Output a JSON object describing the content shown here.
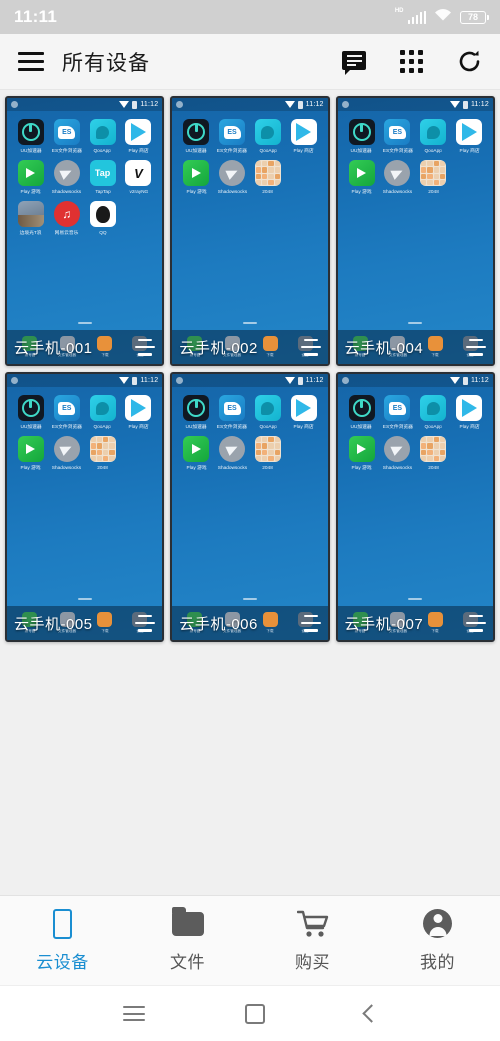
{
  "status_bar": {
    "time": "11:11",
    "signal_icon": "signal-bars-icon",
    "signal_label": "HD",
    "wifi_icon": "wifi-icon",
    "battery_icon": "battery-icon",
    "battery_level": "78"
  },
  "header": {
    "menu_icon": "hamburger-menu-icon",
    "title": "所有设备",
    "actions": [
      {
        "icon": "message-icon"
      },
      {
        "icon": "grid-view-icon"
      },
      {
        "icon": "refresh-icon"
      }
    ]
  },
  "devices": [
    {
      "name": "云手机-001",
      "status_time": "11:12",
      "menu_icon": "device-menu-icon",
      "apps": [
        {
          "label": "UU加速器",
          "icon": "uu-accelerator-icon",
          "style": "ico-uu"
        },
        {
          "label": "ES文件浏览器",
          "icon": "es-file-explorer-icon",
          "style": "ico-es"
        },
        {
          "label": "QooApp",
          "icon": "qooapp-icon",
          "style": "ico-qoo"
        },
        {
          "label": "Play 商店",
          "icon": "google-play-icon",
          "style": "ico-play"
        },
        {
          "label": "Play 游戏",
          "icon": "play-games-icon",
          "style": "ico-playgame"
        },
        {
          "label": "Shadowsocks",
          "icon": "shadowsocks-icon",
          "style": "ico-ss"
        },
        {
          "label": "TapTap",
          "icon": "taptap-icon",
          "style": "ico-tap"
        },
        {
          "label": "v2rayNG",
          "icon": "v2rayng-icon",
          "style": "ico-v2"
        },
        {
          "label": "边境光T浪",
          "icon": "photo-app-icon",
          "style": "ico-photo"
        },
        {
          "label": "网易云音乐",
          "icon": "netease-music-icon",
          "style": "ico-music"
        },
        {
          "label": "QQ",
          "icon": "qq-icon",
          "style": "ico-qq"
        }
      ],
      "dock": [
        {
          "label": "拨号器",
          "icon": "dialer-icon",
          "color": "#2f8f4f"
        },
        {
          "label": "文件管理器",
          "icon": "file-manager-icon",
          "color": "#8c97a4"
        },
        {
          "label": "下载",
          "icon": "download-icon",
          "color": "#e8913a"
        },
        {
          "label": "设置",
          "icon": "settings-icon",
          "color": "#5b6b7c"
        }
      ]
    },
    {
      "name": "云手机-002",
      "status_time": "11:12",
      "menu_icon": "device-menu-icon",
      "apps": [
        {
          "label": "UU加速器",
          "icon": "uu-accelerator-icon",
          "style": "ico-uu"
        },
        {
          "label": "ES文件浏览器",
          "icon": "es-file-explorer-icon",
          "style": "ico-es"
        },
        {
          "label": "QooApp",
          "icon": "qooapp-icon",
          "style": "ico-qoo"
        },
        {
          "label": "Play 商店",
          "icon": "google-play-icon",
          "style": "ico-play"
        },
        {
          "label": "Play 游戏",
          "icon": "play-games-icon",
          "style": "ico-playgame"
        },
        {
          "label": "Shadowsocks",
          "icon": "shadowsocks-icon",
          "style": "ico-ss"
        },
        {
          "label": "2048",
          "icon": "2048-game-icon",
          "style": "ico-2048"
        }
      ],
      "dock": [
        {
          "label": "拨号器",
          "icon": "dialer-icon",
          "color": "#2f8f4f"
        },
        {
          "label": "文件管理器",
          "icon": "file-manager-icon",
          "color": "#8c97a4"
        },
        {
          "label": "下载",
          "icon": "download-icon",
          "color": "#e8913a"
        },
        {
          "label": "设置",
          "icon": "settings-icon",
          "color": "#5b6b7c"
        }
      ]
    },
    {
      "name": "云手机-004",
      "status_time": "11:12",
      "menu_icon": "device-menu-icon",
      "apps": [
        {
          "label": "UU加速器",
          "icon": "uu-accelerator-icon",
          "style": "ico-uu"
        },
        {
          "label": "ES文件浏览器",
          "icon": "es-file-explorer-icon",
          "style": "ico-es"
        },
        {
          "label": "QooApp",
          "icon": "qooapp-icon",
          "style": "ico-qoo"
        },
        {
          "label": "Play 商店",
          "icon": "google-play-icon",
          "style": "ico-play"
        },
        {
          "label": "Play 游戏",
          "icon": "play-games-icon",
          "style": "ico-playgame"
        },
        {
          "label": "Shadowsocks",
          "icon": "shadowsocks-icon",
          "style": "ico-ss"
        },
        {
          "label": "2048",
          "icon": "2048-game-icon",
          "style": "ico-2048"
        }
      ],
      "dock": [
        {
          "label": "拨号器",
          "icon": "dialer-icon",
          "color": "#2f8f4f"
        },
        {
          "label": "文件管理器",
          "icon": "file-manager-icon",
          "color": "#8c97a4"
        },
        {
          "label": "下载",
          "icon": "download-icon",
          "color": "#e8913a"
        },
        {
          "label": "设置",
          "icon": "settings-icon",
          "color": "#5b6b7c"
        }
      ]
    },
    {
      "name": "云手机-005",
      "status_time": "11:12",
      "menu_icon": "device-menu-icon",
      "apps": [
        {
          "label": "UU加速器",
          "icon": "uu-accelerator-icon",
          "style": "ico-uu"
        },
        {
          "label": "ES文件浏览器",
          "icon": "es-file-explorer-icon",
          "style": "ico-es"
        },
        {
          "label": "QooApp",
          "icon": "qooapp-icon",
          "style": "ico-qoo"
        },
        {
          "label": "Play 商店",
          "icon": "google-play-icon",
          "style": "ico-play"
        },
        {
          "label": "Play 游戏",
          "icon": "play-games-icon",
          "style": "ico-playgame"
        },
        {
          "label": "Shadowsocks",
          "icon": "shadowsocks-icon",
          "style": "ico-ss"
        },
        {
          "label": "2048",
          "icon": "2048-game-icon",
          "style": "ico-2048"
        }
      ],
      "dock": [
        {
          "label": "拨号器",
          "icon": "dialer-icon",
          "color": "#2f8f4f"
        },
        {
          "label": "文件管理器",
          "icon": "file-manager-icon",
          "color": "#8c97a4"
        },
        {
          "label": "下载",
          "icon": "download-icon",
          "color": "#e8913a"
        },
        {
          "label": "设置",
          "icon": "settings-icon",
          "color": "#5b6b7c"
        }
      ]
    },
    {
      "name": "云手机-006",
      "status_time": "11:12",
      "menu_icon": "device-menu-icon",
      "apps": [
        {
          "label": "UU加速器",
          "icon": "uu-accelerator-icon",
          "style": "ico-uu"
        },
        {
          "label": "ES文件浏览器",
          "icon": "es-file-explorer-icon",
          "style": "ico-es"
        },
        {
          "label": "QooApp",
          "icon": "qooapp-icon",
          "style": "ico-qoo"
        },
        {
          "label": "Play 商店",
          "icon": "google-play-icon",
          "style": "ico-play"
        },
        {
          "label": "Play 游戏",
          "icon": "play-games-icon",
          "style": "ico-playgame"
        },
        {
          "label": "Shadowsocks",
          "icon": "shadowsocks-icon",
          "style": "ico-ss"
        },
        {
          "label": "2048",
          "icon": "2048-game-icon",
          "style": "ico-2048"
        }
      ],
      "dock": [
        {
          "label": "拨号器",
          "icon": "dialer-icon",
          "color": "#2f8f4f"
        },
        {
          "label": "文件管理器",
          "icon": "file-manager-icon",
          "color": "#8c97a4"
        },
        {
          "label": "下载",
          "icon": "download-icon",
          "color": "#e8913a"
        },
        {
          "label": "设置",
          "icon": "settings-icon",
          "color": "#5b6b7c"
        }
      ]
    },
    {
      "name": "云手机-007",
      "status_time": "11:12",
      "menu_icon": "device-menu-icon",
      "apps": [
        {
          "label": "UU加速器",
          "icon": "uu-accelerator-icon",
          "style": "ico-uu"
        },
        {
          "label": "ES文件浏览器",
          "icon": "es-file-explorer-icon",
          "style": "ico-es"
        },
        {
          "label": "QooApp",
          "icon": "qooapp-icon",
          "style": "ico-qoo"
        },
        {
          "label": "Play 商店",
          "icon": "google-play-icon",
          "style": "ico-play"
        },
        {
          "label": "Play 游戏",
          "icon": "play-games-icon",
          "style": "ico-playgame"
        },
        {
          "label": "Shadowsocks",
          "icon": "shadowsocks-icon",
          "style": "ico-ss"
        },
        {
          "label": "2048",
          "icon": "2048-game-icon",
          "style": "ico-2048"
        }
      ],
      "dock": [
        {
          "label": "拨号器",
          "icon": "dialer-icon",
          "color": "#2f8f4f"
        },
        {
          "label": "文件管理器",
          "icon": "file-manager-icon",
          "color": "#8c97a4"
        },
        {
          "label": "下载",
          "icon": "download-icon",
          "color": "#e8913a"
        },
        {
          "label": "设置",
          "icon": "settings-icon",
          "color": "#5b6b7c"
        }
      ]
    }
  ],
  "tabbar": {
    "active_color": "#1a8ed1",
    "items": [
      {
        "label": "云设备",
        "icon": "cloud-device-icon",
        "active": true
      },
      {
        "label": "文件",
        "icon": "folder-icon",
        "active": false
      },
      {
        "label": "购买",
        "icon": "shopping-cart-icon",
        "active": false
      },
      {
        "label": "我的",
        "icon": "profile-icon",
        "active": false
      }
    ]
  },
  "navbar": {
    "items": [
      {
        "icon": "recent-apps-icon"
      },
      {
        "icon": "home-icon"
      },
      {
        "icon": "back-icon"
      }
    ]
  }
}
